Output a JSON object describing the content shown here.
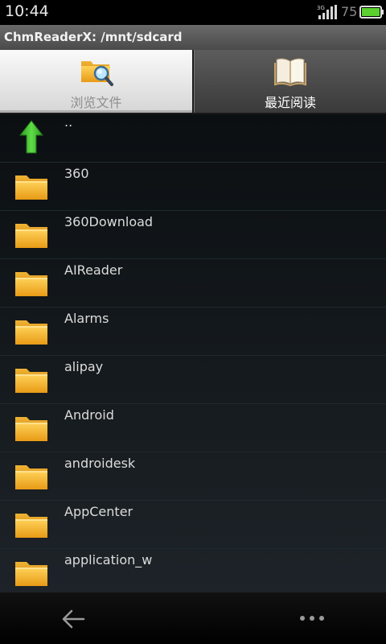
{
  "status_bar": {
    "time": "10:44",
    "signal_icon": "signal-3g-icon",
    "network_label": "3G",
    "battery_level": "75",
    "battery_icon": "battery-icon"
  },
  "title_bar": {
    "title": "ChmReaderX: /mnt/sdcard"
  },
  "tabs": [
    {
      "label": "浏览文件",
      "icon": "folder-search-icon",
      "selected": true
    },
    {
      "label": "最近阅读",
      "icon": "open-book-icon",
      "selected": false
    }
  ],
  "file_list": [
    {
      "name": "..",
      "icon": "up-arrow-icon"
    },
    {
      "name": "360",
      "icon": "folder-icon"
    },
    {
      "name": "360Download",
      "icon": "folder-icon"
    },
    {
      "name": "AIReader",
      "icon": "folder-icon"
    },
    {
      "name": "Alarms",
      "icon": "folder-icon"
    },
    {
      "name": "alipay",
      "icon": "folder-icon"
    },
    {
      "name": "Android",
      "icon": "folder-icon"
    },
    {
      "name": "androidesk",
      "icon": "folder-icon"
    },
    {
      "name": "AppCenter",
      "icon": "folder-icon"
    },
    {
      "name": "application_w",
      "icon": "folder-icon"
    }
  ],
  "nav_bar": {
    "back_icon": "back-arrow-icon",
    "menu_icon": "more-dots-icon"
  },
  "colors": {
    "folder": "#f5b62a",
    "up_arrow": "#3cbc2c",
    "battery": "#5ad12e"
  }
}
